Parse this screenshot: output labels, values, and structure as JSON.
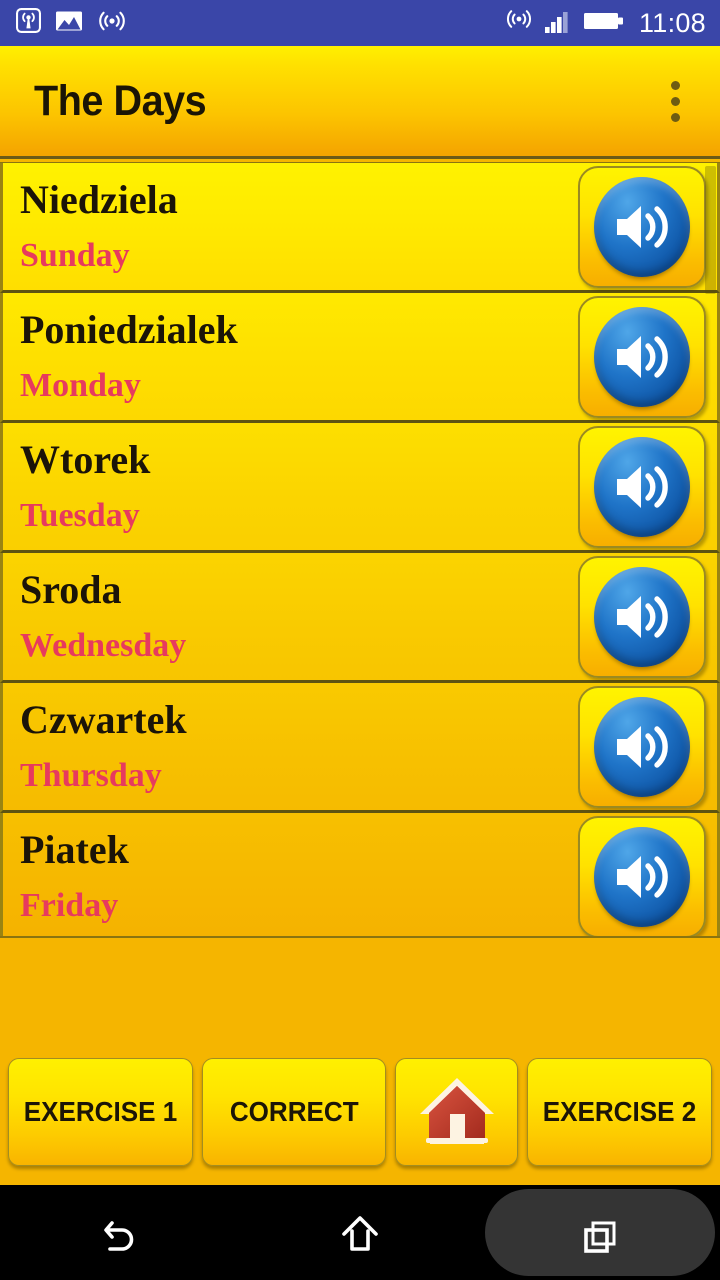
{
  "statusbar": {
    "time": "11:08",
    "left_icons": [
      {
        "name": "broadcast-tower-icon"
      },
      {
        "name": "picture-icon"
      },
      {
        "name": "wireless-signal-icon"
      }
    ],
    "right_icons": [
      {
        "name": "hotspot-icon"
      },
      {
        "name": "cellular-signal-icon"
      },
      {
        "name": "battery-full-icon"
      }
    ],
    "background_color": "#3A46A8"
  },
  "appbar": {
    "title": "The Days",
    "overflow_label": "more-options",
    "accent_top": "#FFF000",
    "accent_bottom": "#F4A300"
  },
  "list": {
    "scrollbar_visible": true,
    "items": [
      {
        "native": "Niedziela",
        "translation": "Sunday",
        "speaker_label": "play-sound"
      },
      {
        "native": "Poniedzialek",
        "translation": "Monday",
        "speaker_label": "play-sound"
      },
      {
        "native": "Wtorek",
        "translation": "Tuesday",
        "speaker_label": "play-sound"
      },
      {
        "native": "Sroda",
        "translation": "Wednesday",
        "speaker_label": "play-sound"
      },
      {
        "native": "Czwartek",
        "translation": "Thursday",
        "speaker_label": "play-sound"
      },
      {
        "native": "Piatek",
        "translation": "Friday",
        "speaker_label": "play-sound"
      }
    ],
    "native_color": "#1b1408",
    "translation_color": "#E73A5E"
  },
  "bottom_bar": {
    "buttons": [
      {
        "id": "exercise-1",
        "label": "EXERCISE 1",
        "type": "text"
      },
      {
        "id": "correct",
        "label": "CORRECT",
        "type": "text"
      },
      {
        "id": "home",
        "label": "",
        "type": "icon",
        "icon": "home-icon"
      },
      {
        "id": "exercise-2",
        "label": "EXERCISE 2",
        "type": "text"
      }
    ]
  },
  "navbar": {
    "buttons": [
      {
        "id": "back",
        "icon": "back-arrow-icon"
      },
      {
        "id": "home",
        "icon": "home-outline-icon"
      },
      {
        "id": "recents",
        "icon": "recents-squares-icon",
        "highlighted": true
      }
    ],
    "background_color": "#000000"
  }
}
